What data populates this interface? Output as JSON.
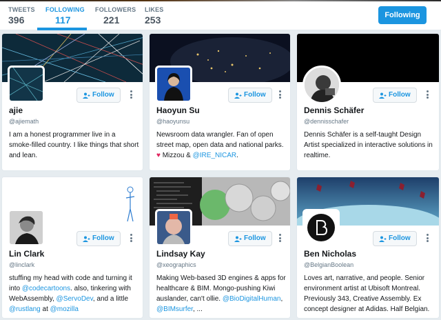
{
  "stats": [
    {
      "label": "TWEETS",
      "value": "396"
    },
    {
      "label": "FOLLOWING",
      "value": "117"
    },
    {
      "label": "FOLLOWERS",
      "value": "221"
    },
    {
      "label": "LIKES",
      "value": "253"
    }
  ],
  "header": {
    "following_button": "Following"
  },
  "follow_label": "Follow",
  "cards": [
    {
      "name": "ajie",
      "handle": "@ajiemath",
      "bio": "I am a honest programmer live in a smoke-filled country. I like things that short and lean."
    },
    {
      "name": "Haoyun Su",
      "handle": "@haoyunsu",
      "bio_text": "Newsroom data wrangler. Fan of open street map, open data and national parks.",
      "bio_heart": "♥",
      "bio_mid": " Mizzou & ",
      "bio_link": "@IRE_NICAR",
      "bio_end": "."
    },
    {
      "name": "Dennis Schäfer",
      "handle": "@dennisschafer",
      "bio": "Dennis Schäfer is a self-taught Design Artist specialized in interactive solutions in realtime."
    },
    {
      "name": "Lin Clark",
      "handle": "@linclark",
      "bio_a": "stuffing my head with code and turning it into ",
      "bio_link1": "@codecartoons",
      "bio_b": ". also, tinkering with WebAssembly, ",
      "bio_link2": "@ServoDev",
      "bio_c": ", and a little ",
      "bio_link3": "@rustlang",
      "bio_d": " at ",
      "bio_link4": "@mozilla"
    },
    {
      "name": "Lindsay Kay",
      "handle": "@xeographics",
      "bio_a": "Making Web-based 3D engines & apps for healthcare & BIM. Mongo-pushing Kiwi auslander, can't ollie. ",
      "bio_link1": "@BioDigitalHuman",
      "bio_b": ", ",
      "bio_link2": "@BIMsurfer",
      "bio_c": ", ..."
    },
    {
      "name": "Ben Nicholas",
      "handle": "@BelgianBoolean",
      "bio": "Loves art, narrative, and people. Senior environment artist at Ubisoft Montreal. Previously 343, Creative Assembly. Ex concept designer at Adidas. Half Belgian."
    }
  ],
  "colors": {
    "accent": "#1b95e0",
    "heart": "#e0245e"
  }
}
